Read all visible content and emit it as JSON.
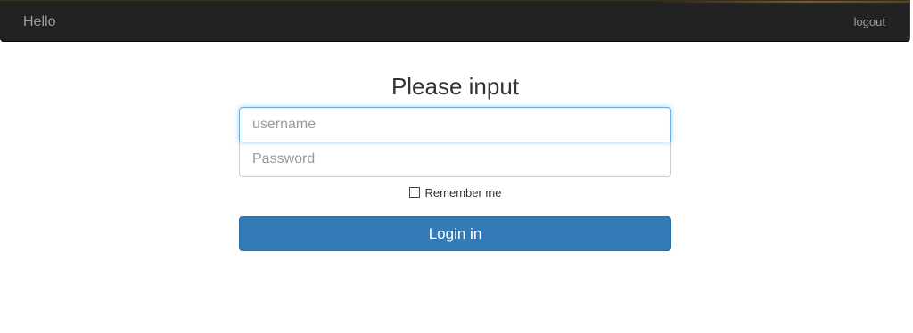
{
  "navbar": {
    "brand": "Hello",
    "logout_label": "logout",
    "background_color": "#222222",
    "text_color": "#9d9d9d"
  },
  "form": {
    "heading": "Please input",
    "username_placeholder": "username",
    "password_placeholder": "Password",
    "remember_label": "Remember me",
    "remember_checked": false,
    "submit_label": "Login in",
    "submit_color": "#337ab7",
    "focus_color": "#66afe9"
  }
}
